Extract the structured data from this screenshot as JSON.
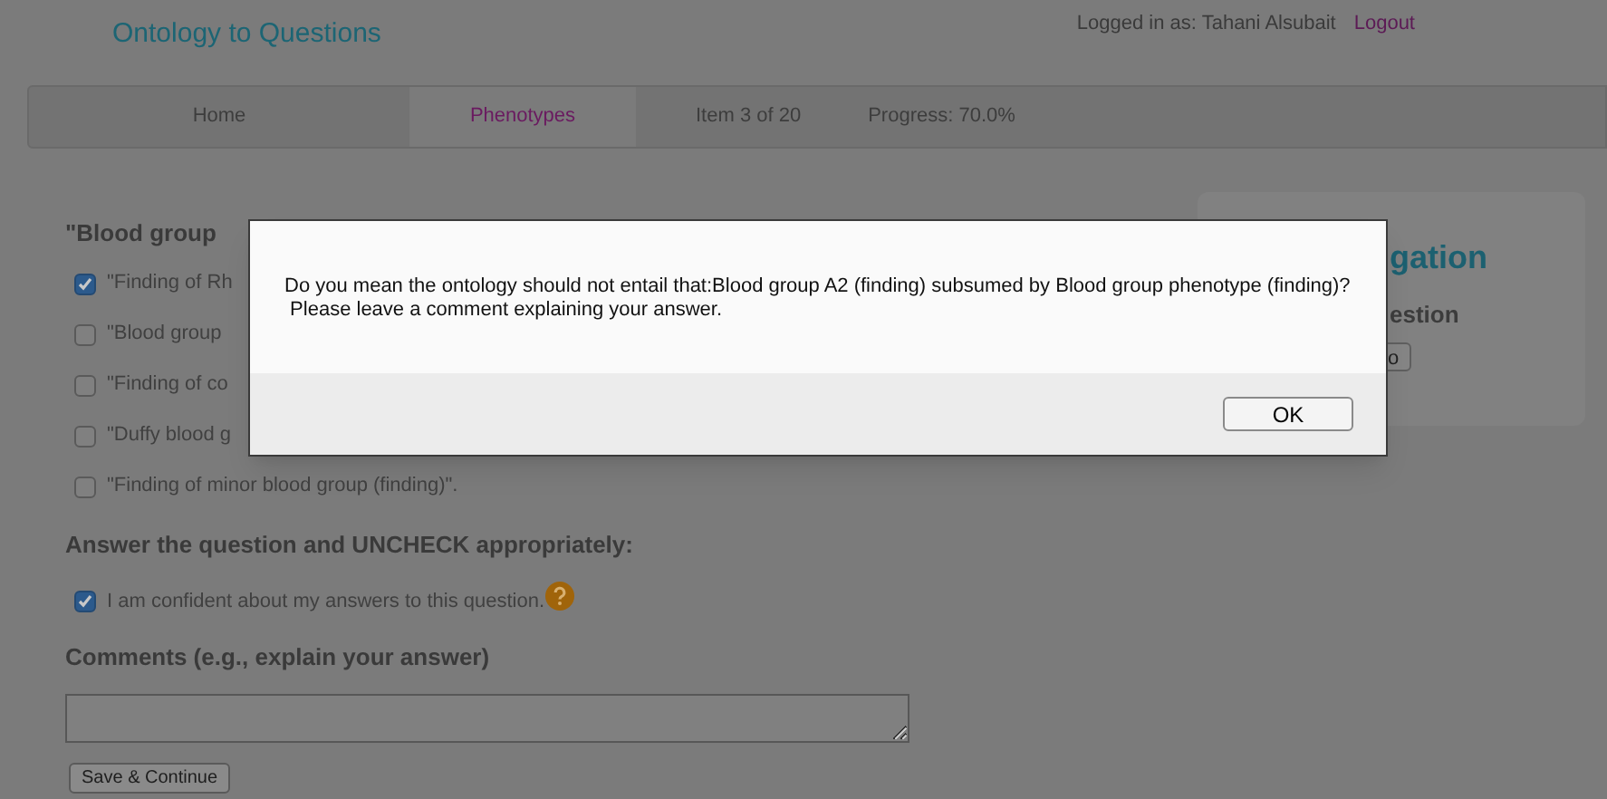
{
  "header": {
    "title": "Ontology to Questions",
    "logged_in": "Logged in as: Tahani Alsubait",
    "logout": "Logout"
  },
  "nav": {
    "items": [
      {
        "label": "Home",
        "selected": false
      },
      {
        "label": "Phenotypes",
        "selected": true
      }
    ],
    "item_counter": "Item 3 of 20",
    "progress": "Progress: 70.0%"
  },
  "question": {
    "heading": "\"Blood group",
    "options": [
      {
        "label": "\"Finding of Rh",
        "checked": true
      },
      {
        "label": "\"Blood group",
        "checked": false
      },
      {
        "label": "\"Finding of co",
        "checked": false
      },
      {
        "label": "\"Duffy blood g",
        "checked": false
      },
      {
        "label": "\"Finding of minor blood group (finding)\".",
        "checked": false
      }
    ]
  },
  "answer": {
    "heading": "Answer the question and UNCHECK appropriately:",
    "confident": {
      "label": "I am confident about my answers to this question.",
      "checked": true
    },
    "comments_heading": "Comments (e.g., explain your answer)",
    "save_button": "Save & Continue"
  },
  "quick_navigation": {
    "heading": "gation",
    "subheading": "estion",
    "go_button": "o"
  },
  "dialog": {
    "message": "Do you mean the ontology should not entail that:Blood group A2 (finding) subsumed by Blood group phenotype (finding)?\n Please leave a comment explaining your answer.",
    "ok_button": "OK"
  }
}
